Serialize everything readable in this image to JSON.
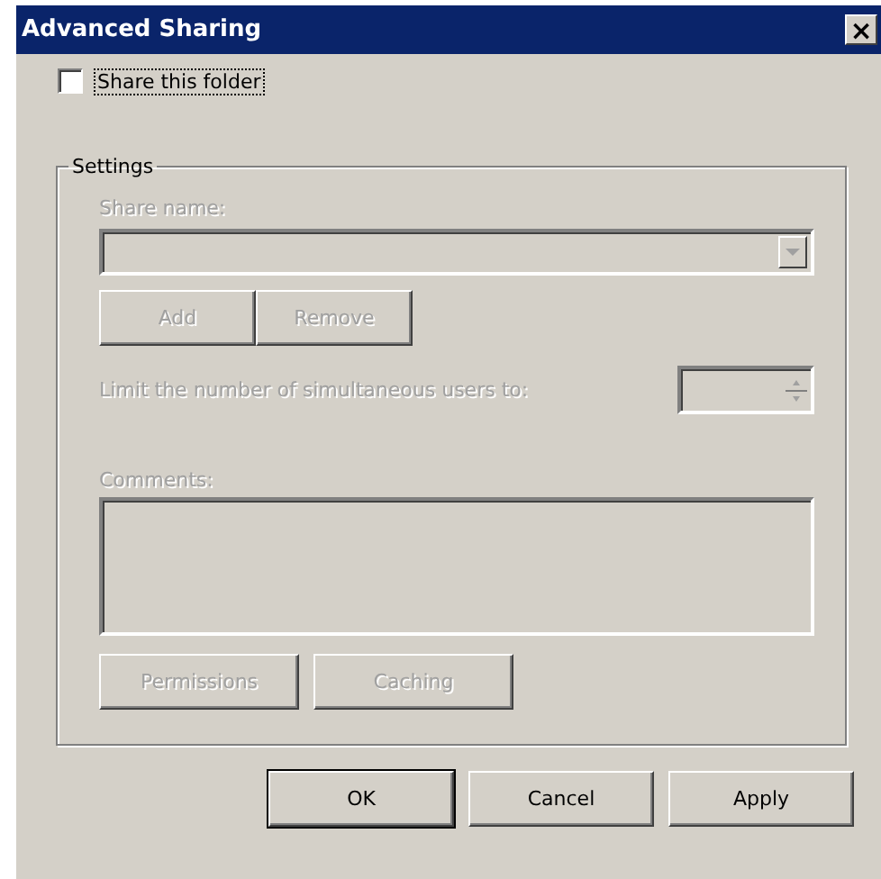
{
  "window": {
    "title": "Advanced Sharing",
    "close": "×"
  },
  "share_checkbox": {
    "label": "Share this folder",
    "checked": false
  },
  "settings": {
    "title": "Settings",
    "disabled": true,
    "share_name": {
      "label": "Share name:"
    },
    "share_buttons": [
      {
        "label": "Add"
      },
      {
        "label": "Remove"
      }
    ],
    "limit": {
      "label": "Limit the number of simultaneous users to:"
    },
    "comments": {
      "label": "Comments:"
    },
    "buttons": [
      {
        "label": "Permissions"
      },
      {
        "label": "Caching"
      }
    ]
  },
  "buttons": [
    {
      "label": "OK",
      "default": true
    },
    {
      "label": "Cancel",
      "default": false
    },
    {
      "label": "Apply",
      "default": false
    }
  ]
}
